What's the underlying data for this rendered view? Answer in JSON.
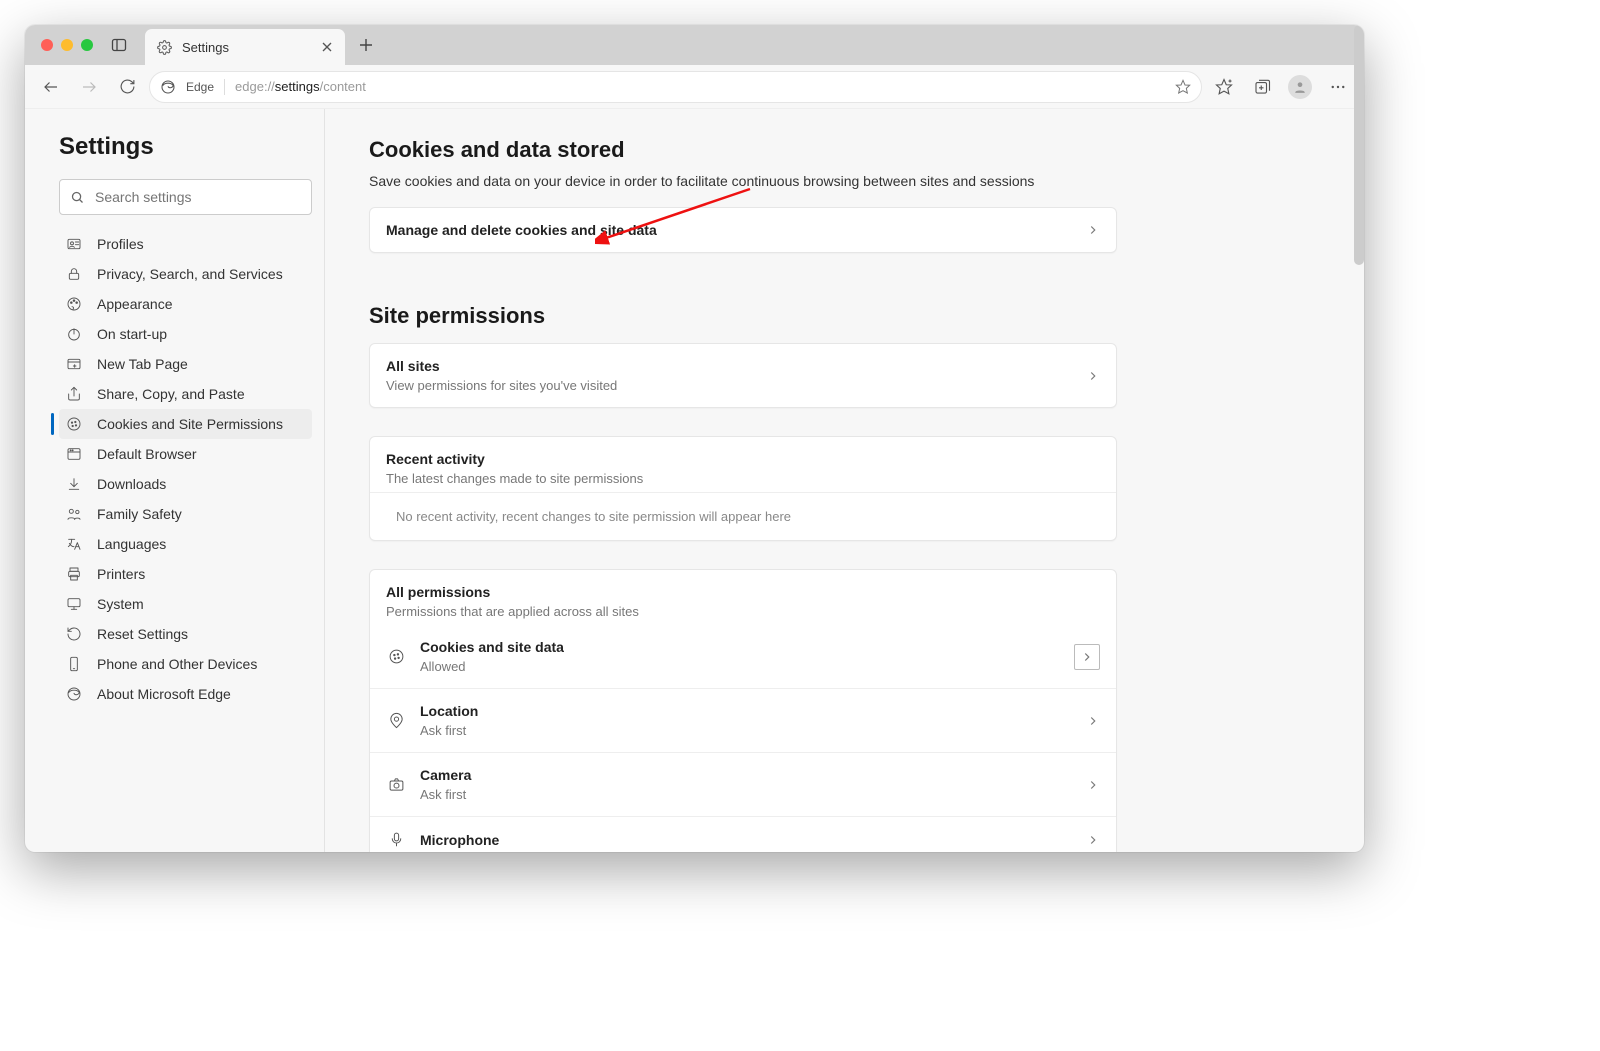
{
  "tab": {
    "title": "Settings"
  },
  "toolbar": {
    "product": "Edge",
    "url_prefix": "edge://",
    "url_path": "settings",
    "url_trail": "/content"
  },
  "sidebar": {
    "heading": "Settings",
    "search_placeholder": "Search settings",
    "items": [
      {
        "label": "Profiles",
        "icon": "user-card"
      },
      {
        "label": "Privacy, Search, and Services",
        "icon": "lock"
      },
      {
        "label": "Appearance",
        "icon": "paint"
      },
      {
        "label": "On start-up",
        "icon": "power"
      },
      {
        "label": "New Tab Page",
        "icon": "tab"
      },
      {
        "label": "Share, Copy, and Paste",
        "icon": "share"
      },
      {
        "label": "Cookies and Site Permissions",
        "icon": "cookie"
      },
      {
        "label": "Default Browser",
        "icon": "browser"
      },
      {
        "label": "Downloads",
        "icon": "download"
      },
      {
        "label": "Family Safety",
        "icon": "family"
      },
      {
        "label": "Languages",
        "icon": "language"
      },
      {
        "label": "Printers",
        "icon": "printer"
      },
      {
        "label": "System",
        "icon": "system"
      },
      {
        "label": "Reset Settings",
        "icon": "reset"
      },
      {
        "label": "Phone and Other Devices",
        "icon": "phone"
      },
      {
        "label": "About Microsoft Edge",
        "icon": "edge"
      }
    ],
    "active_index": 6
  },
  "main": {
    "cookies": {
      "title": "Cookies and data stored",
      "subtitle": "Save cookies and data on your device in order to facilitate continuous browsing between sites and sessions",
      "manage_label": "Manage and delete cookies and site data"
    },
    "permissions_title": "Site permissions",
    "all_sites": {
      "title": "All sites",
      "sub": "View permissions for sites you've visited"
    },
    "recent": {
      "title": "Recent activity",
      "sub": "The latest changes made to site permissions",
      "empty": "No recent activity, recent changes to site permission will appear here"
    },
    "all_perms": {
      "title": "All permissions",
      "sub": "Permissions that are applied across all sites",
      "items": [
        {
          "label": "Cookies and site data",
          "status": "Allowed",
          "icon": "cookie",
          "boxed": true
        },
        {
          "label": "Location",
          "status": "Ask first",
          "icon": "location"
        },
        {
          "label": "Camera",
          "status": "Ask first",
          "icon": "camera"
        },
        {
          "label": "Microphone",
          "status": "",
          "icon": "microphone"
        }
      ]
    }
  }
}
